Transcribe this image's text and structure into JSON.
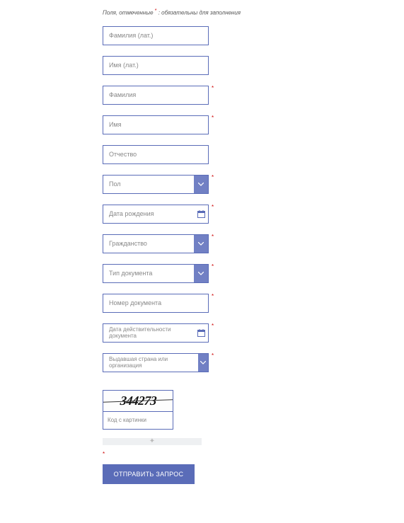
{
  "hint_prefix": "Поля, отмеченные ",
  "hint_suffix": " : обязательны для заполнения",
  "asterisk": "*",
  "fields": {
    "surname_lat": "Фамилия (лат.)",
    "name_lat": "Имя (лат.)",
    "surname": "Фамилия",
    "name": "Имя",
    "patronymic": "Отчество",
    "gender": "Пол",
    "dob": "Дата рождения",
    "citizenship": "Гражданство",
    "doc_type": "Тип документа",
    "doc_number": "Номер документа",
    "doc_validity": "Дата действительности документа",
    "issuing": "Выдавшая страна или организация"
  },
  "captcha": {
    "image_text": "344273",
    "input_label": "Код с картинки"
  },
  "submit_label": "ОТПРАВИТЬ ЗАПРОС"
}
